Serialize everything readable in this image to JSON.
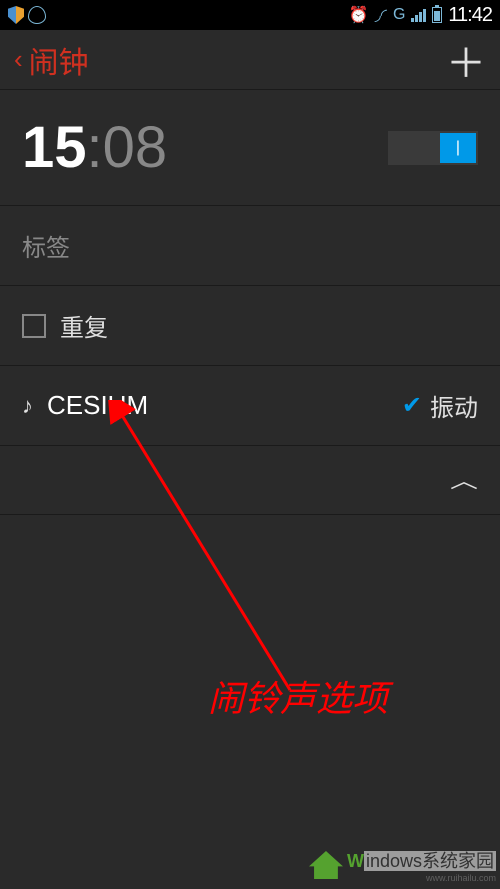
{
  "status_bar": {
    "network_label": "G",
    "time": "11:42"
  },
  "header": {
    "title": "闹钟"
  },
  "alarm": {
    "hour": "15",
    "minute": "08",
    "toggle_on": "|",
    "label_placeholder": "标签",
    "repeat_label": "重复",
    "ringtone_name": "CESIUM",
    "vibrate_label": "振动"
  },
  "annotation": {
    "text": "闹铃声选项"
  },
  "watermark": {
    "brand_w": "W",
    "brand_rest": "indows系统家园",
    "url": "www.ruihailu.com"
  }
}
